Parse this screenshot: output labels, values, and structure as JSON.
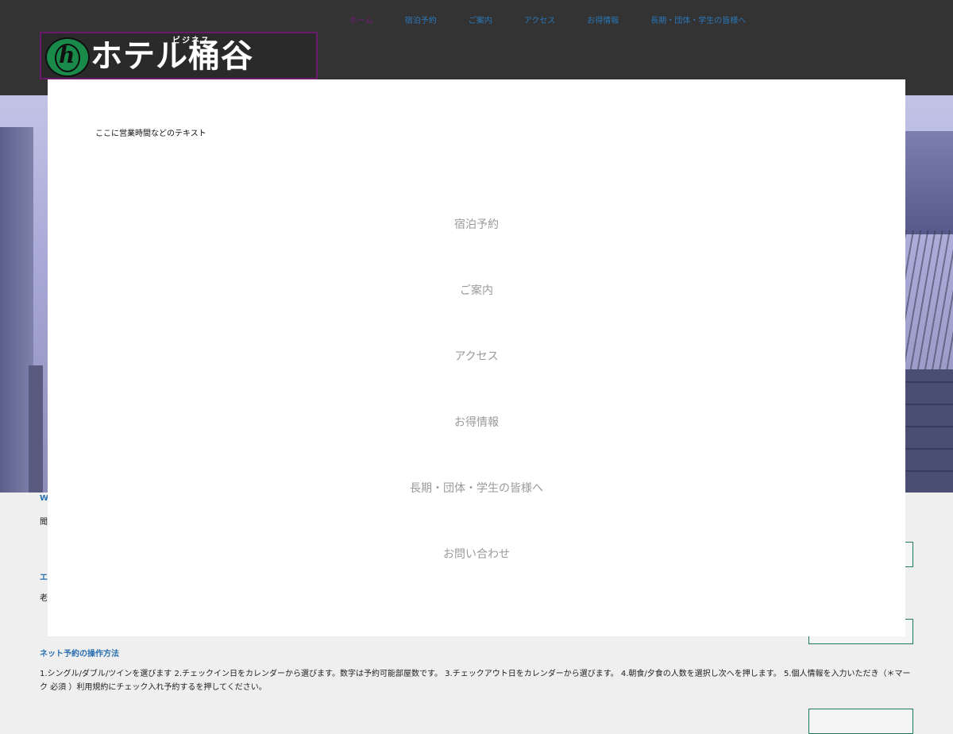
{
  "nav": {
    "items": [
      {
        "label": "ホーム",
        "active": true
      },
      {
        "label": "宿泊予約"
      },
      {
        "label": "ご案内"
      },
      {
        "label": "アクセス"
      },
      {
        "label": "お得情報"
      },
      {
        "label": "長期・団体・学生の皆様へ"
      }
    ]
  },
  "logo": {
    "small_text": "ビジネス",
    "main_text": "ホテル桶谷",
    "badge_letter": "h"
  },
  "overlay": {
    "hours_text": "ここに営業時間などのテキスト",
    "menu": [
      "宿泊予約",
      "ご案内",
      "アクセス",
      "お得情報",
      "長期・団体・学生の皆様へ",
      "お問い合わせ"
    ]
  },
  "content": {
    "peek_title1": "W",
    "peek_text1": "聞",
    "peek_title2": "エ",
    "peek_text2": "老",
    "howto_title": "ネット予約の操作方法",
    "howto_text": "1.シングル/ダブル/ツインを選びます 2.チェックイン日をカレンダーから選びます。数字は予約可能部屋数です。 3.チェックアウト日をカレンダーから選びます。 4.朝食/夕食の人数を選択し次へを押します。 5.個人情報を入力いただき（＊マーク 必須 ）利用規約にチェック入れ予約するを押してください。"
  },
  "colors": {
    "header_bg": "#333333",
    "nav_link": "#2a77b8",
    "nav_active": "#7a1a7a",
    "heading_blue": "#2a6fb0",
    "box_border": "#1f7a5a"
  }
}
